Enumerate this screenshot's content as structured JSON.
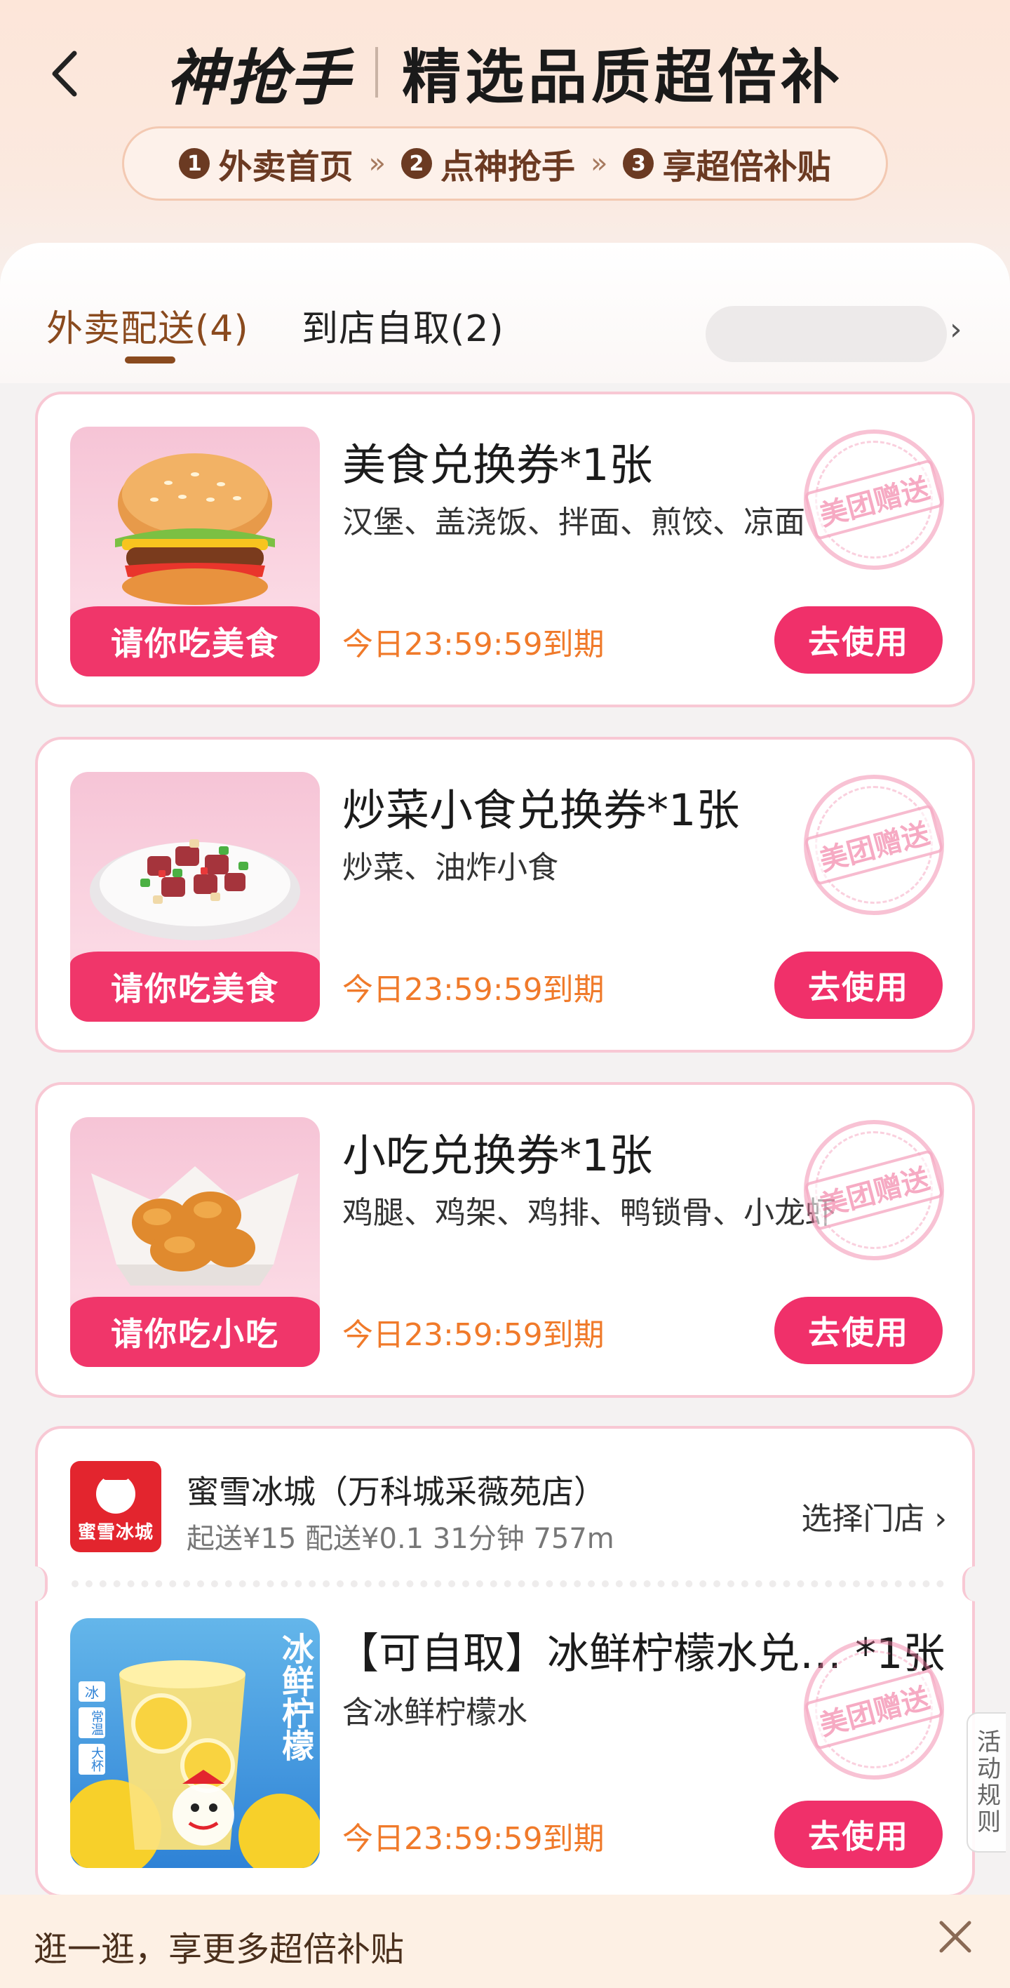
{
  "header": {
    "brand": "神抢手",
    "title": "精选品质超倍补",
    "steps": [
      {
        "num": "1",
        "label": "外卖首页"
      },
      {
        "num": "2",
        "label": "点神抢手"
      },
      {
        "num": "3",
        "label": "享超倍补贴"
      }
    ],
    "separator": "»"
  },
  "tabs": {
    "active": "外卖配送(4)",
    "inactive": "到店自取(2)",
    "chevron": "›"
  },
  "coupons": [
    {
      "title": "美食兑换券*1张",
      "desc": "汉堡、盖浇饭、拌面、煎饺、凉面",
      "banner": "请你吃美食",
      "expiry": "今日23:59:59到期",
      "button": "去使用",
      "stamp": "美团赠送",
      "image": "burger"
    },
    {
      "title": "炒菜小食兑换券*1张",
      "desc": "炒菜、油炸小食",
      "banner": "请你吃美食",
      "expiry": "今日23:59:59到期",
      "button": "去使用",
      "stamp": "美团赠送",
      "image": "stir-fry"
    },
    {
      "title": "小吃兑换券*1张",
      "desc": "鸡腿、鸡架、鸡排、鸭锁骨、小龙虾",
      "banner": "请你吃小吃",
      "expiry": "今日23:59:59到期",
      "button": "去使用",
      "stamp": "美团赠送",
      "image": "fried-chicken"
    }
  ],
  "store": {
    "logo_text": "蜜雪冰城",
    "name": "蜜雪冰城（万科城采薇苑店）",
    "meta": "起送¥15  配送¥0.1  31分钟  757m",
    "select": "选择门店 ›",
    "item": {
      "title": "【可自取】冰鲜柠檬水兑…  *1张",
      "desc": "含冰鲜柠檬水",
      "expiry": "今日23:59:59到期",
      "button": "去使用",
      "stamp": "美团赠送",
      "cup_text": "冰鲜柠檬",
      "cup_tags": [
        "冰",
        "常温",
        "大杯"
      ]
    }
  },
  "rules_tab": "活动规则",
  "bottom": {
    "text": "逛一逛，享更多超倍补贴"
  },
  "colors": {
    "accent": "#f0306a",
    "expiry": "#f07a2a",
    "brown": "#8a4a1e",
    "card_border": "#f8c8d4"
  }
}
